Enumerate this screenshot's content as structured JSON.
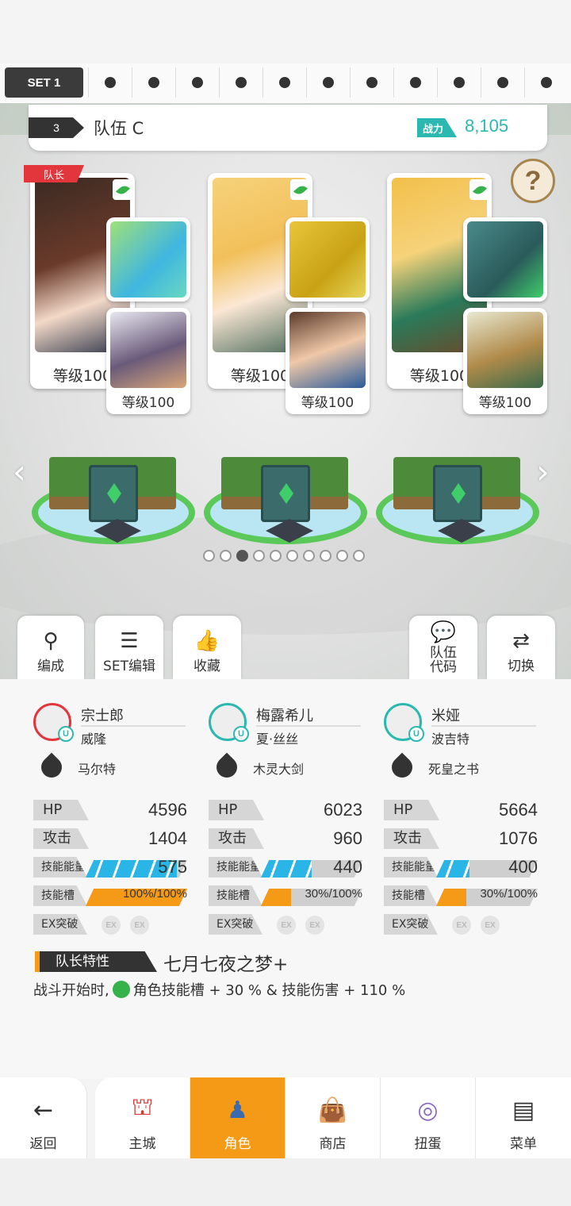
{
  "set_bar": {
    "current": "SET 1"
  },
  "team": {
    "number": "3",
    "name": "队伍 C",
    "power_label": "战力",
    "power_value": "8,105"
  },
  "help": "?",
  "leader_tag": "队长",
  "heroes": [
    {
      "level": "等级100",
      "sub_level": "等级100"
    },
    {
      "level": "等级100",
      "sub_level": "等级100"
    },
    {
      "level": "等级100",
      "sub_level": "等级100"
    }
  ],
  "arrows": {
    "left": "‹",
    "right": "›"
  },
  "pager": {
    "count": 10,
    "active": 2
  },
  "actions": {
    "formation": "编成",
    "set_edit": "SET编辑",
    "favorite": "收藏",
    "team_code": "队伍\n代码",
    "switch": "切换"
  },
  "columns": [
    {
      "name": "宗士郎",
      "sub": "威隆",
      "weapon": "马尔特",
      "hp_label": "HP",
      "hp": "4596",
      "atk_label": "攻击",
      "atk": "1404",
      "energy_label": "技能能量",
      "energy": "575",
      "energy_frac": 0.9,
      "slot_label": "技能槽",
      "slot": "100%/100%",
      "slot_frac": 1.0,
      "ex_label": "EX突破",
      "ex": "EX"
    },
    {
      "name": "梅露希儿",
      "sub": "夏·丝丝",
      "weapon": "木灵大剑",
      "hp_label": "HP",
      "hp": "6023",
      "atk_label": "攻击",
      "atk": "960",
      "energy_label": "技能能量",
      "energy": "440",
      "energy_frac": 0.5,
      "slot_label": "技能槽",
      "slot": "30%/100%",
      "slot_frac": 0.3,
      "ex_label": "EX突破",
      "ex": "EX"
    },
    {
      "name": "米娅",
      "sub": "波吉特",
      "weapon": "死皇之书",
      "hp_label": "HP",
      "hp": "5664",
      "atk_label": "攻击",
      "atk": "1076",
      "energy_label": "技能能量",
      "energy": "400",
      "energy_frac": 0.33,
      "slot_label": "技能槽",
      "slot": "30%/100%",
      "slot_frac": 0.3,
      "ex_label": "EX突破",
      "ex": "EX"
    }
  ],
  "leader_trait": {
    "label": "队长特性",
    "name": "七月七夜之梦+",
    "desc_a": "战斗开始时,",
    "desc_b": "角色技能槽 + 30 % & 技能伤害 + 110 %"
  },
  "nav": {
    "back": "返回",
    "home": "主城",
    "character": "角色",
    "shop": "商店",
    "gacha": "扭蛋",
    "menu": "菜单"
  },
  "colors": {
    "accent": "#f49a16",
    "teal": "#2bb8b0",
    "leader_red": "#e2363c",
    "energy_blue": "#29b6e6",
    "leaf_green": "#35b34a"
  }
}
